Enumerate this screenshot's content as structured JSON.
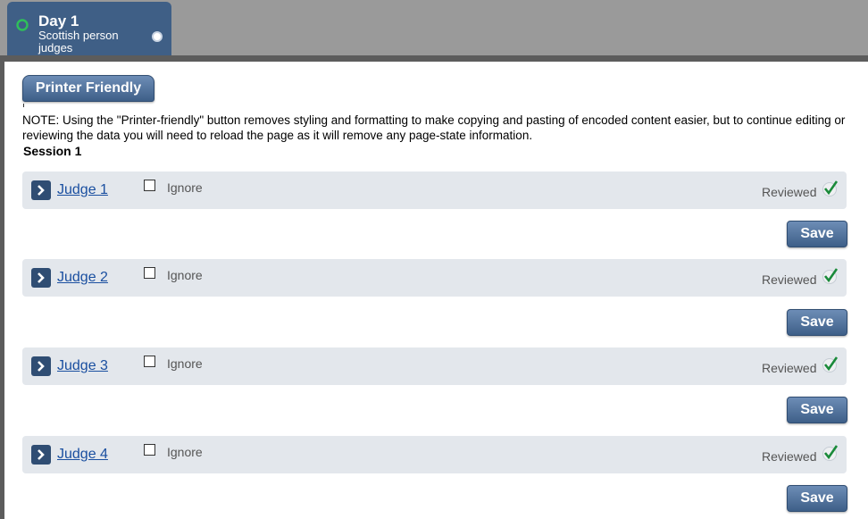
{
  "day_tab": {
    "title": "Day 1",
    "subtitle": "Scottish person judges"
  },
  "toolbar": {
    "printer_friendly_label": "Printer Friendly"
  },
  "note": "NOTE: Using the \"Printer-friendly\" button removes styling and formatting to make copying and pasting of encoded content easier, but to continue editing or reviewing the data you will need to reload the page as it will remove any page-state information.",
  "session": {
    "title": "Session 1",
    "judges": [
      {
        "name": "Judge 1",
        "ignore_label": "Ignore",
        "reviewed_label": "Reviewed",
        "save_label": "Save"
      },
      {
        "name": "Judge 2",
        "ignore_label": "Ignore",
        "reviewed_label": "Reviewed",
        "save_label": "Save"
      },
      {
        "name": "Judge 3",
        "ignore_label": "Ignore",
        "reviewed_label": "Reviewed",
        "save_label": "Save"
      },
      {
        "name": "Judge 4",
        "ignore_label": "Ignore",
        "reviewed_label": "Reviewed",
        "save_label": "Save"
      }
    ]
  },
  "colors": {
    "tab_blue": "#3f5f86",
    "row_background": "#e3e7ec",
    "link_blue": "#1a4fa0",
    "check_green": "#1a8a3a"
  }
}
